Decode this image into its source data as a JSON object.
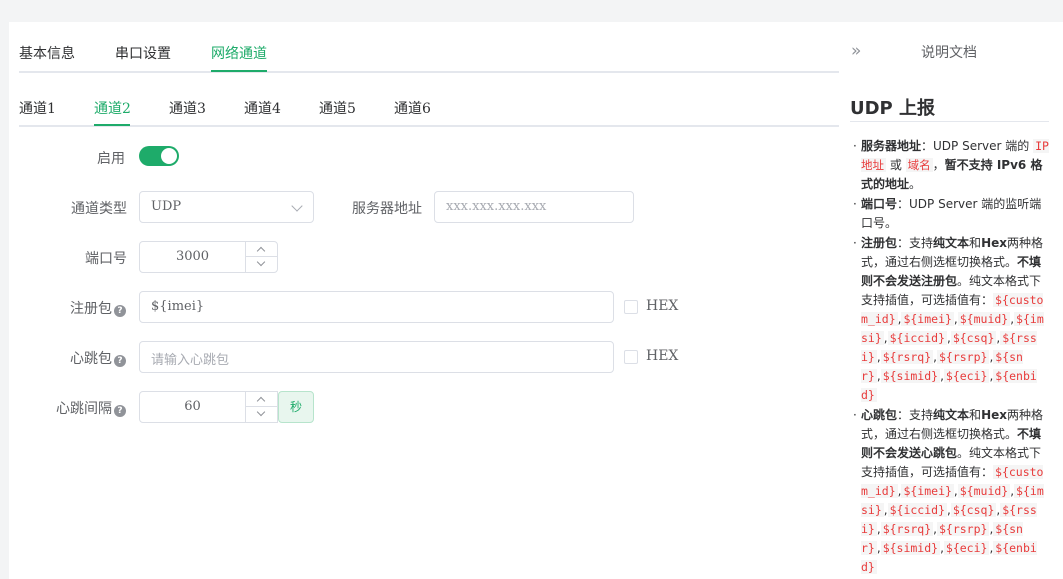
{
  "tabs": [
    "基本信息",
    "串口设置",
    "网络通道"
  ],
  "channel_tabs": [
    "通道1",
    "通道2",
    "通道3",
    "通道4",
    "通道5",
    "通道6"
  ],
  "form": {
    "enable_label": "启用",
    "enabled": true,
    "type_label": "通道类型",
    "type_value": "UDP",
    "server_label": "服务器地址",
    "server_placeholder": "xxx.xxx.xxx.xxx",
    "port_label": "端口号",
    "port_value": "3000",
    "reg_label": "注册包",
    "reg_value": "${imei}",
    "hex_label": "HEX",
    "hb_label": "心跳包",
    "hb_placeholder": "请输入心跳包",
    "interval_label": "心跳间隔",
    "interval_value": "60",
    "interval_unit": "秒",
    "help_glyph": "?"
  },
  "side": {
    "chevron": "»",
    "title": "说明文档",
    "heading": "UDP 上报"
  },
  "doc": {
    "i1a": "服务器地址",
    "i1b": "：UDP Server 端的 ",
    "i1c": "IP地址",
    "i1d": " 或 ",
    "i1e": "域名",
    "i1f": "，",
    "i1g": "暂不支持 IPv6 格式的地址",
    "i1h": "。",
    "i2a": "端口号",
    "i2b": "：UDP Server 端的监听端口号。",
    "i3a": "注册包",
    "i3b": "：支持",
    "i3c": "纯文本",
    "i3d": "和",
    "i3e": "Hex",
    "i3f": "两种格式，通过右侧选框切换格式。",
    "i3g": "不填则不会发送注册包",
    "i3h": "。纯文本格式下支持插值，可选插值有：",
    "i4a": "心跳包",
    "i4b": "：支持",
    "i4c": "纯文本",
    "i4d": "和",
    "i4e": "Hex",
    "i4f": "两种格式，通过右侧选框切换格式。",
    "i4g": "不填则不会发送心跳包",
    "i4h": "。纯文本格式下支持插值，可选插值有：",
    "sep": ",",
    "vars": [
      "${custom_id}",
      "${imei}",
      "${muid}",
      "${imsi}",
      "${iccid}",
      "${csq}",
      "${rssi}",
      "${rsrq}",
      "${rsrp}",
      "${snr}",
      "${simid}",
      "${eci}",
      "${enbid}"
    ]
  },
  "colors": {
    "accent": "#1eab6a",
    "code": "#e83b3b"
  }
}
